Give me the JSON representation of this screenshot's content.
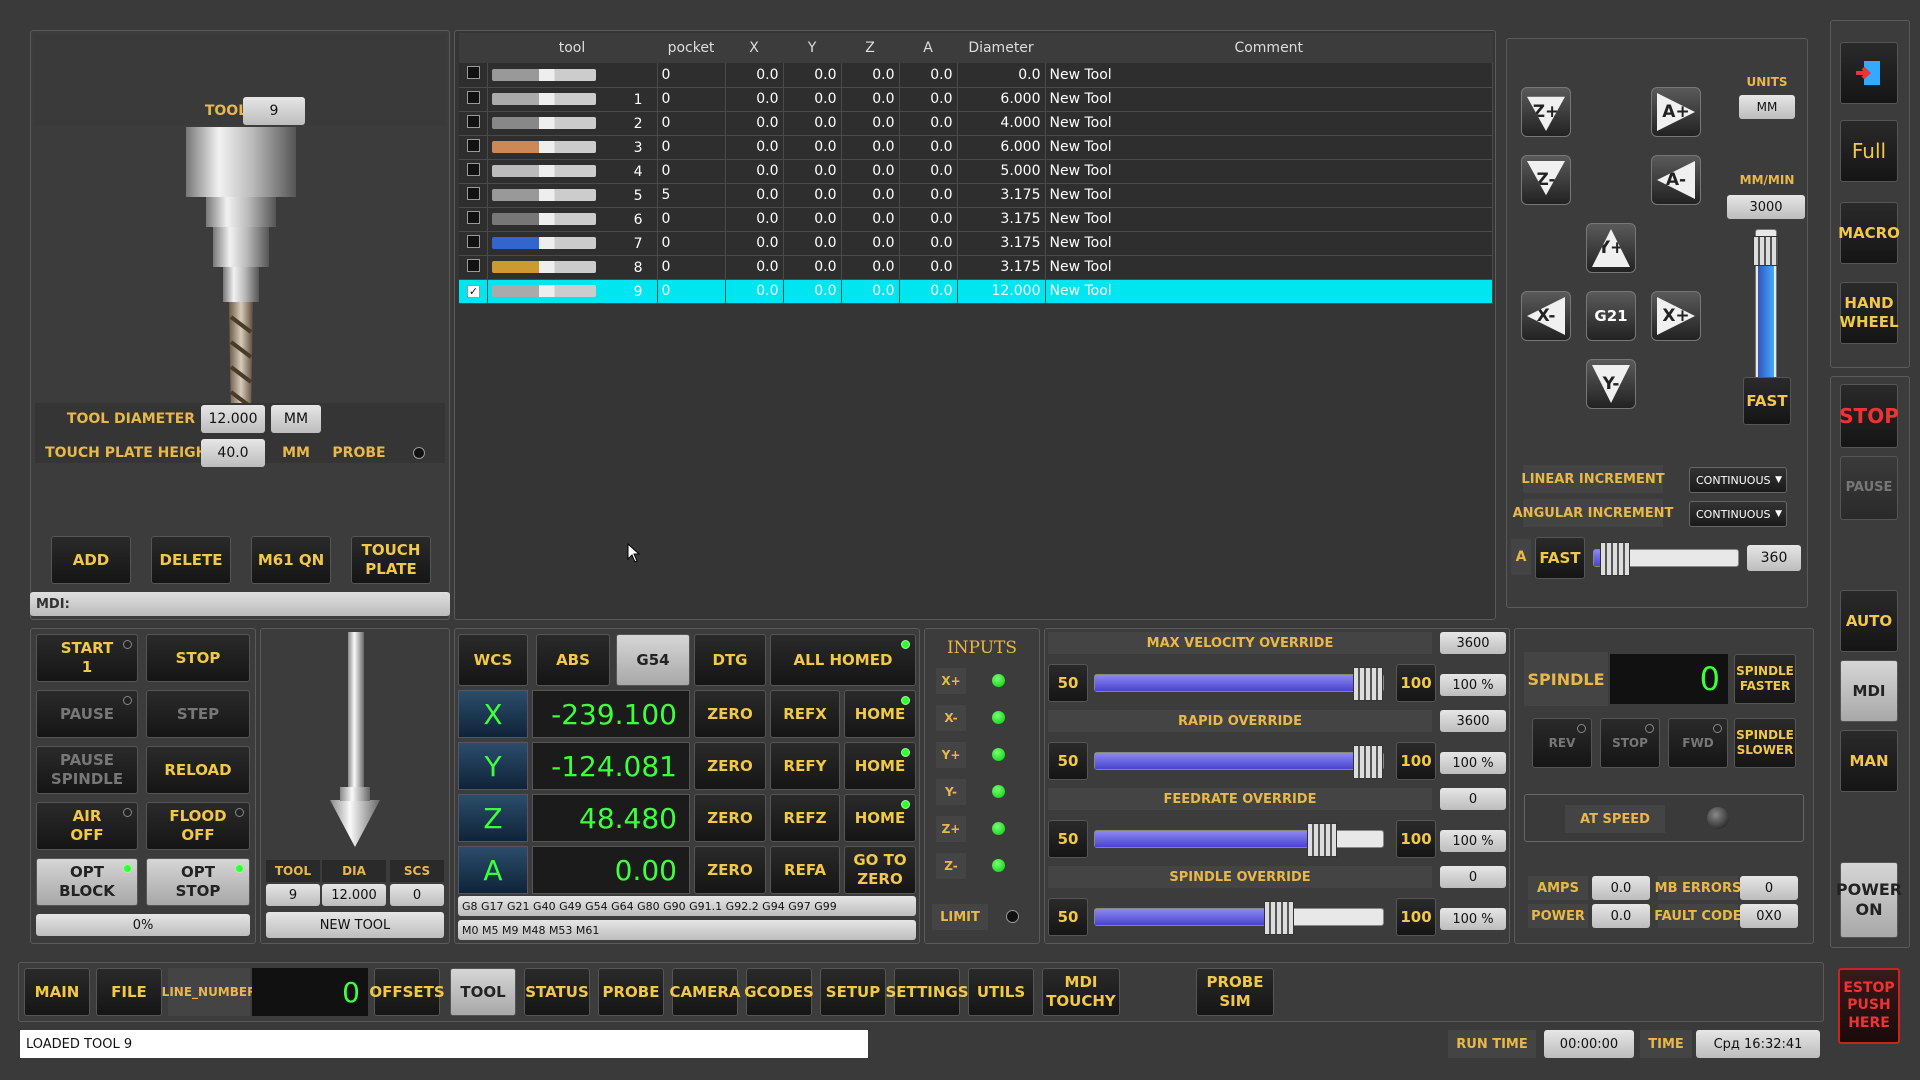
{
  "tool_panel": {
    "tool_label": "TOOL",
    "tool_value": "9",
    "diameter_label": "TOOL DIAMETER",
    "diameter_value": "12.000",
    "diameter_unit": "MM",
    "plate_label": "TOUCH PLATE HEIGHT",
    "plate_value": "40.0",
    "plate_unit": "MM",
    "probe_label": "PROBE",
    "buttons": [
      "ADD",
      "DELETE",
      "M61 QN",
      "TOUCH PLATE"
    ],
    "mdi_label": "MDI:"
  },
  "tool_table": {
    "headers": [
      "tool",
      "pocket",
      "X",
      "Y",
      "Z",
      "A",
      "Diameter",
      "Comment"
    ],
    "rows": [
      {
        "tool": "",
        "pocket": "0",
        "x": "0.0",
        "y": "0.0",
        "z": "0.0",
        "a": "0.0",
        "dia": "0.0",
        "comment": "New Tool",
        "checked": false,
        "selected": false
      },
      {
        "tool": "1",
        "pocket": "0",
        "x": "0.0",
        "y": "0.0",
        "z": "0.0",
        "a": "0.0",
        "dia": "6.000",
        "comment": "New Tool",
        "checked": false,
        "selected": false
      },
      {
        "tool": "2",
        "pocket": "0",
        "x": "0.0",
        "y": "0.0",
        "z": "0.0",
        "a": "0.0",
        "dia": "4.000",
        "comment": "New Tool",
        "checked": false,
        "selected": false
      },
      {
        "tool": "3",
        "pocket": "0",
        "x": "0.0",
        "y": "0.0",
        "z": "0.0",
        "a": "0.0",
        "dia": "6.000",
        "comment": "New Tool",
        "checked": false,
        "selected": false
      },
      {
        "tool": "4",
        "pocket": "0",
        "x": "0.0",
        "y": "0.0",
        "z": "0.0",
        "a": "0.0",
        "dia": "5.000",
        "comment": "New Tool",
        "checked": false,
        "selected": false
      },
      {
        "tool": "5",
        "pocket": "5",
        "x": "0.0",
        "y": "0.0",
        "z": "0.0",
        "a": "0.0",
        "dia": "3.175",
        "comment": "New Tool",
        "checked": false,
        "selected": false
      },
      {
        "tool": "6",
        "pocket": "0",
        "x": "0.0",
        "y": "0.0",
        "z": "0.0",
        "a": "0.0",
        "dia": "3.175",
        "comment": "New Tool",
        "checked": false,
        "selected": false
      },
      {
        "tool": "7",
        "pocket": "0",
        "x": "0.0",
        "y": "0.0",
        "z": "0.0",
        "a": "0.0",
        "dia": "3.175",
        "comment": "New Tool",
        "checked": false,
        "selected": false
      },
      {
        "tool": "8",
        "pocket": "0",
        "x": "0.0",
        "y": "0.0",
        "z": "0.0",
        "a": "0.0",
        "dia": "3.175",
        "comment": "New Tool",
        "checked": false,
        "selected": false
      },
      {
        "tool": "9",
        "pocket": "0",
        "x": "0.0",
        "y": "0.0",
        "z": "0.0",
        "a": "0.0",
        "dia": "12.000",
        "comment": "New Tool",
        "checked": true,
        "selected": true
      }
    ]
  },
  "jog": {
    "buttons": [
      "Z+",
      "A+",
      "Z-",
      "A-",
      "Y+",
      "X-",
      "G21",
      "X+",
      "Y-"
    ],
    "units_label": "UNITS",
    "units_value": "MM",
    "rate_label": "MM/MIN",
    "rate_value": "3000",
    "fast_label": "FAST",
    "linear_label": "LINEAR INCREMENT",
    "linear_value": "CONTINUOUS",
    "angular_label": "ANGULAR INCREMENT",
    "angular_value": "CONTINUOUS",
    "a_label": "A",
    "a_fast": "FAST",
    "a_value": "360"
  },
  "right_bar": {
    "full": "Full",
    "macro": "MACRO",
    "handwheel": "HAND WHEEL",
    "stop": "STOP",
    "pause": "PAUSE",
    "auto": "AUTO",
    "mdi": "MDI",
    "man": "MAN",
    "power": "POWER ON",
    "estop": "ESTOP PUSH HERE"
  },
  "run_panel": {
    "start": "START",
    "start_line": "1",
    "stop": "STOP",
    "pause": "PAUSE",
    "step": "STEP",
    "pause_spindle": "PAUSE SPINDLE",
    "reload": "RELOAD",
    "air": "AIR OFF",
    "flood": "FLOOD OFF",
    "opt_block": "OPT BLOCK",
    "opt_stop": "OPT STOP",
    "progress": "0%"
  },
  "tool_info": {
    "tool_label": "TOOL",
    "dia_label": "DIA",
    "scs_label": "SCS",
    "tool_value": "9",
    "dia_value": "12.000",
    "scs_value": "0",
    "name": "NEW TOOL"
  },
  "dro": {
    "wcs": "WCS",
    "abs": "ABS",
    "g54": "G54",
    "dtg": "DTG",
    "all_homed": "ALL HOMED",
    "axes": [
      {
        "axis": "X",
        "value": "-239.100",
        "ref": "REFX",
        "home": "HOME"
      },
      {
        "axis": "Y",
        "value": "-124.081",
        "ref": "REFY",
        "home": "HOME"
      },
      {
        "axis": "Z",
        "value": "48.480",
        "ref": "REFZ",
        "home": "HOME"
      },
      {
        "axis": "A",
        "value": "0.00",
        "ref": "REFA",
        "home": "GO TO ZERO"
      }
    ],
    "zero": "ZERO",
    "gcodes": "G8 G17 G21 G40 G49 G54 G64 G80 G90 G91.1 G92.2 G94 G97 G99",
    "mcodes": "M0 M5 M9 M48 M53 M61"
  },
  "inputs": {
    "title": "INPUTS",
    "items": [
      "X+",
      "X-",
      "Y+",
      "Y-",
      "Z+",
      "Z-"
    ],
    "limit": "LIMIT"
  },
  "overrides": [
    {
      "title": "MAX VELOCITY OVERRIDE",
      "value": "3600",
      "percent": "100 %",
      "min": "50",
      "max": "100",
      "level": 0.96
    },
    {
      "title": "RAPID OVERRIDE",
      "value": "3600",
      "percent": "100 %",
      "min": "50",
      "max": "100",
      "level": 0.96
    },
    {
      "title": "FEEDRATE OVERRIDE",
      "value": "0",
      "percent": "100 %",
      "min": "50",
      "max": "100",
      "level": 0.8
    },
    {
      "title": "SPINDLE OVERRIDE",
      "value": "0",
      "percent": "100 %",
      "min": "50",
      "max": "100",
      "level": 0.65
    }
  ],
  "spindle": {
    "label": "SPINDLE",
    "rpm": "0",
    "faster": "SPINDLE FASTER",
    "slower": "SPINDLE SLOWER",
    "rev": "REV",
    "stop": "STOP",
    "fwd": "FWD",
    "at_speed": "AT SPEED",
    "amps_label": "AMPS",
    "amps": "0.0",
    "mb_label": "MB ERRORS",
    "mb": "0",
    "power_label": "POWER",
    "power": "0.0",
    "fault_label": "FAULT CODE",
    "fault": "0X0"
  },
  "tabs": {
    "main": "MAIN",
    "file": "FILE",
    "line_label": "LINE_NUMBER",
    "line_value": "0",
    "offsets": "OFFSETS",
    "tool": "TOOL",
    "status": "STATUS",
    "probe": "PROBE",
    "camera": "CAMERA",
    "gcodes": "GCODES",
    "setup": "SETUP",
    "settings": "SETTINGS",
    "utils": "UTILS",
    "mdi_touchy": "MDI TOUCHY",
    "probe_sim": "PROBE SIM"
  },
  "status_bar": {
    "message": "LOADED TOOL 9",
    "run_time_label": "RUN TIME",
    "run_time": "00:00:00",
    "time_label": "TIME",
    "time": "Срд 16:32:41"
  }
}
